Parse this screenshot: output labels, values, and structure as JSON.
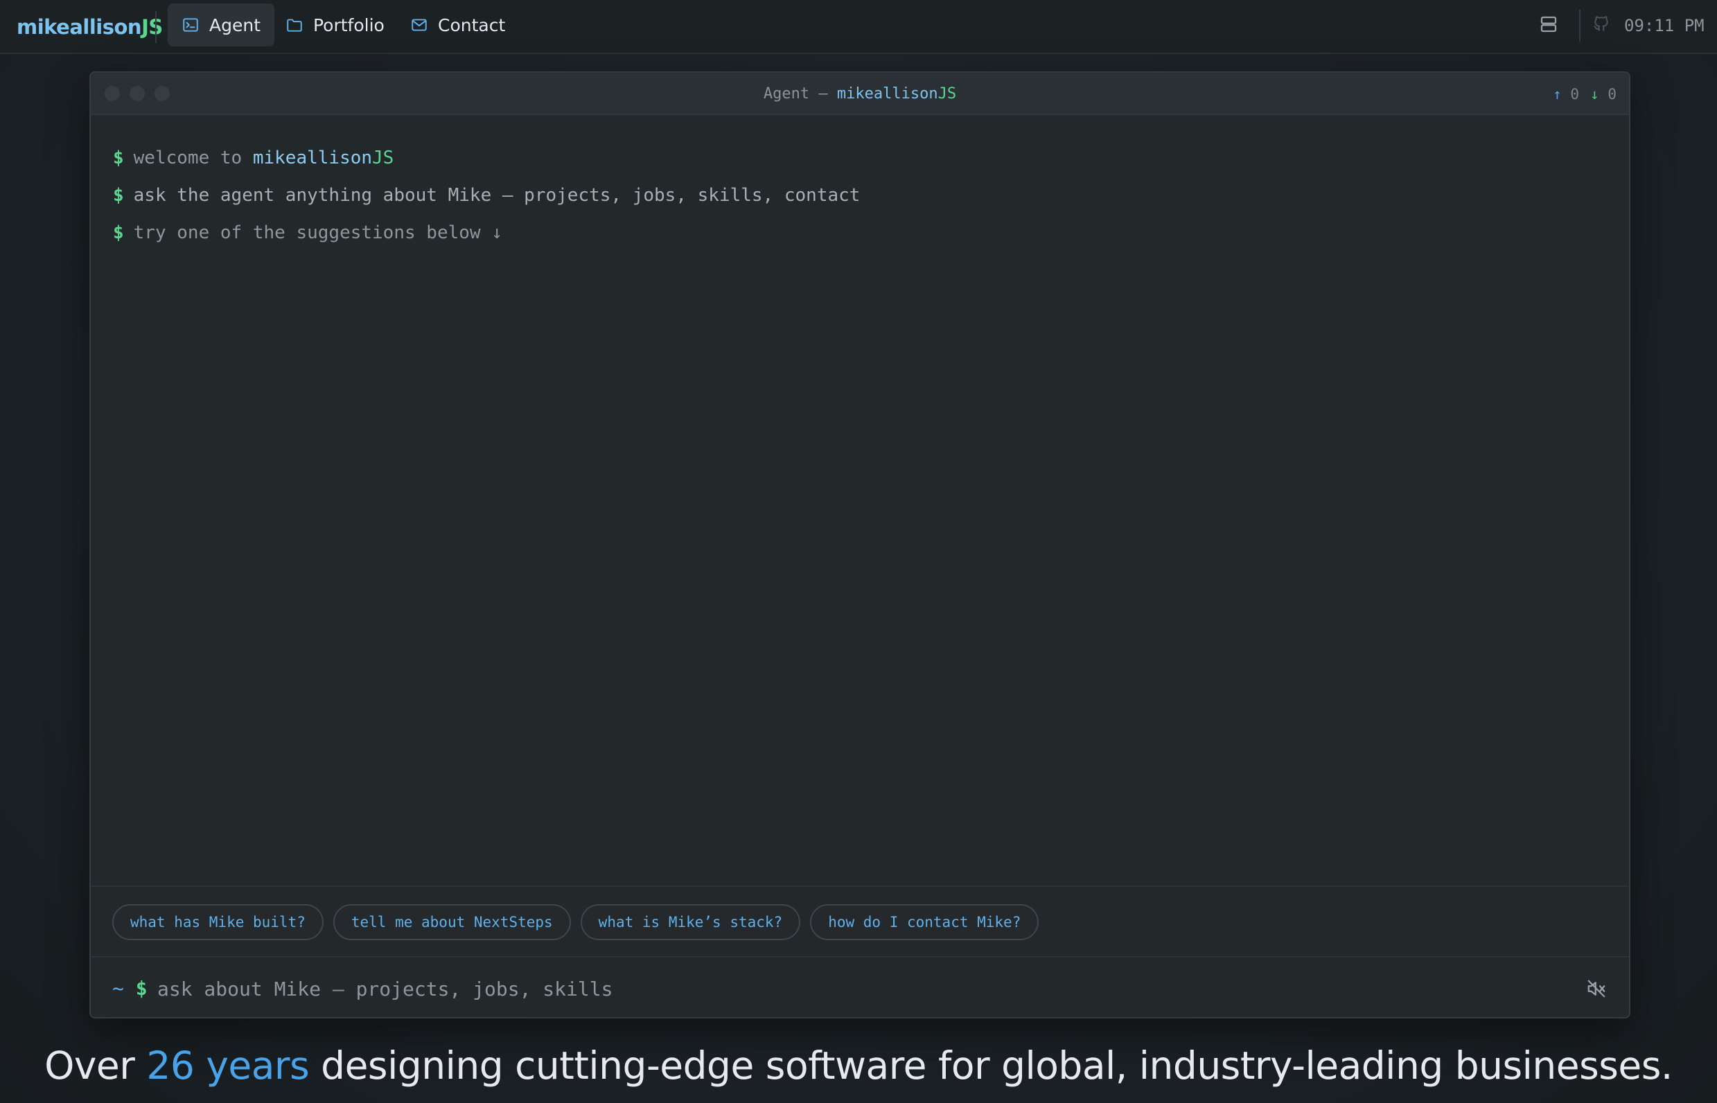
{
  "brand": {
    "name": "mikeallison",
    "suffix": "JS"
  },
  "nav": {
    "items": [
      {
        "label": "Agent",
        "icon": "terminal-icon",
        "active": true
      },
      {
        "label": "Portfolio",
        "icon": "folder-icon",
        "active": false
      },
      {
        "label": "Contact",
        "icon": "mail-icon",
        "active": false
      }
    ]
  },
  "topbar": {
    "layout_icon": "layout-toggle-icon",
    "github_icon": "github-icon",
    "time": "09:11 PM"
  },
  "terminal": {
    "title_prefix": "Agent — ",
    "title_brand": "mikeallison",
    "title_suffix": "JS",
    "counters": {
      "up_arrow": "↑",
      "up": "0",
      "down_arrow": "↓",
      "down": "0"
    },
    "lines": {
      "prompt": "$",
      "welcome_prefix": "welcome to ",
      "welcome_brand": "mikeallison",
      "welcome_suffix": "JS",
      "ask": "ask the agent anything about Mike — projects, jobs, skills, contact",
      "try": "try one of the suggestions below ↓"
    },
    "suggestions": [
      "what has Mike built?",
      "tell me about NextSteps",
      "what is Mike’s stack?",
      "how do I contact Mike?"
    ],
    "input": {
      "tilde": "~",
      "prompt": "$",
      "placeholder": "ask about Mike — projects, jobs, skills",
      "value": ""
    },
    "mute_icon": "speaker-muted-icon"
  },
  "tagline": {
    "before": "Over ",
    "highlight": "26 years",
    "after": " designing cutting-edge software for global, industry-leading businesses."
  },
  "colors": {
    "accent_blue": "#4aa3e8",
    "accent_green": "#5cd68f",
    "background": "#1e2326",
    "terminal_bg": "#23282b"
  }
}
